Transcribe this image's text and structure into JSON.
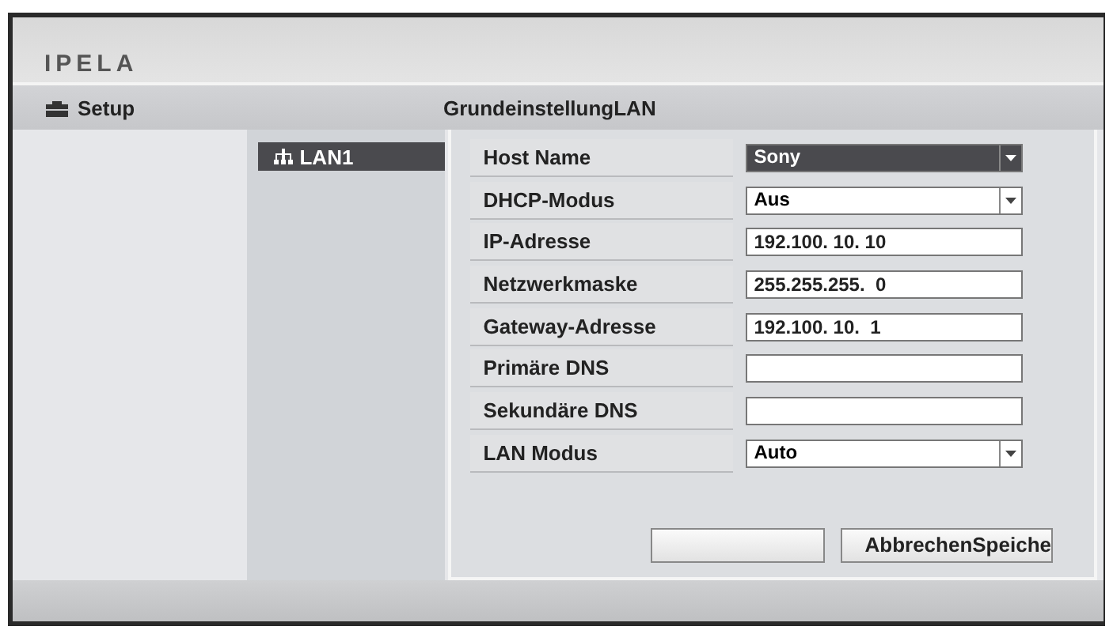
{
  "logo": "IPELA",
  "nav": {
    "setup": "Setup",
    "title": "GrundeinstellungLAN"
  },
  "menu": [
    {
      "label": "LAN1",
      "selected": true
    }
  ],
  "fields": [
    {
      "label": "Host Name",
      "kind": "select",
      "value": "Sony",
      "highlighted": true
    },
    {
      "label": "DHCP-Modus",
      "kind": "select",
      "value": "Aus",
      "highlighted": false
    },
    {
      "label": "IP-Adresse",
      "kind": "input",
      "value": "192.100. 10. 10",
      "highlighted": false
    },
    {
      "label": "Netzwerkmaske",
      "kind": "input",
      "value": "255.255.255.  0",
      "highlighted": false
    },
    {
      "label": "Gateway-Adresse",
      "kind": "input",
      "value": "192.100. 10.  1",
      "highlighted": false
    },
    {
      "label": "Primäre DNS",
      "kind": "input",
      "highlighted": false
    },
    {
      "label": "Sekundäre DNS",
      "kind": "input",
      "highlighted": false
    },
    {
      "label": "LAN Modus",
      "kind": "select",
      "value": "Auto",
      "highlighted": false
    }
  ],
  "buttons": [
    {
      "kind": "blank"
    },
    {
      "kind": "text",
      "label": "AbbrechenSpeiche"
    }
  ]
}
